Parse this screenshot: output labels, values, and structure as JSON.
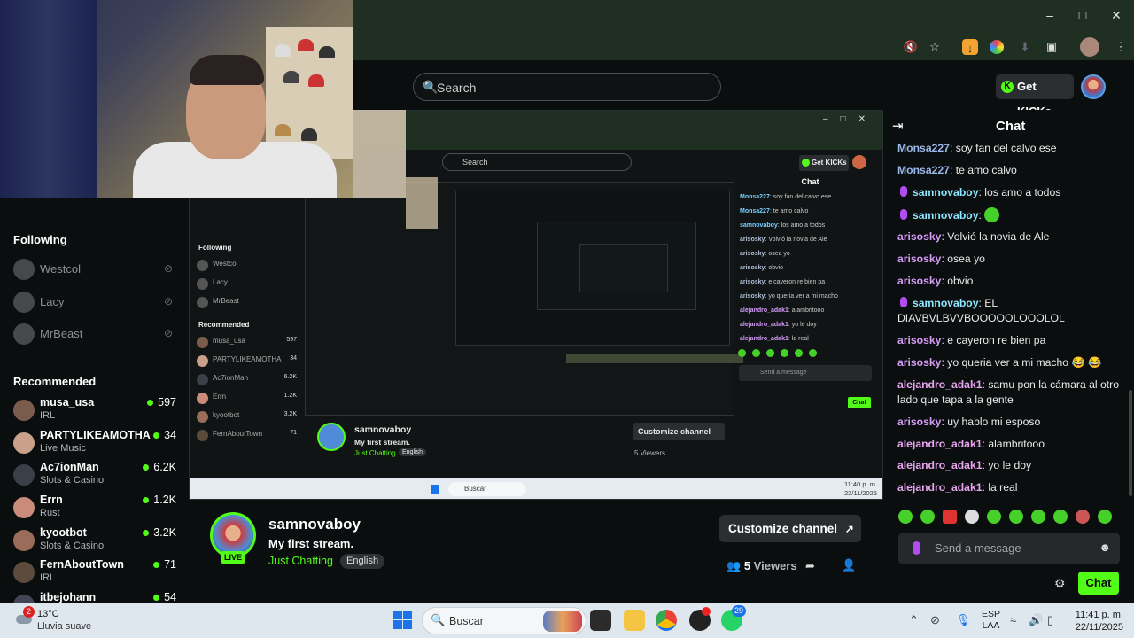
{
  "browser": {
    "toolbar_icons": [
      "mute-tab-icon",
      "bookmark-star-icon",
      "download-icon",
      "extension-icon",
      "profile-avatar"
    ]
  },
  "header": {
    "search_placeholder": "Search",
    "get_kicks_label": "Get KICKs"
  },
  "sidebar": {
    "following_title": "Following",
    "following": [
      {
        "name": "Westcol"
      },
      {
        "name": "Lacy"
      },
      {
        "name": "MrBeast"
      }
    ],
    "recommended_title": "Recommended",
    "recommended": [
      {
        "name": "musa_usa",
        "category": "IRL",
        "viewers": "597",
        "color": "#7a5c4c"
      },
      {
        "name": "PARTYLIKEAMOTHA",
        "category": "Live Music",
        "viewers": "34",
        "color": "#c9a08a"
      },
      {
        "name": "Ac7ionMan",
        "category": "Slots & Casino",
        "viewers": "6.2K",
        "color": "#3b3f48"
      },
      {
        "name": "Errn",
        "category": "Rust",
        "viewers": "1.2K",
        "color": "#c98b7a"
      },
      {
        "name": "kyootbot",
        "category": "Slots & Casino",
        "viewers": "3.2K",
        "color": "#9a6c5a"
      },
      {
        "name": "FernAboutTown",
        "category": "IRL",
        "viewers": "71",
        "color": "#5c4a3c"
      },
      {
        "name": "itbejohann",
        "category": "",
        "viewers": "54",
        "color": "#445"
      }
    ]
  },
  "stream": {
    "channel_name": "samnovaboy",
    "title": "My first stream.",
    "category": "Just Chatting",
    "language": "English",
    "live_label": "LIVE",
    "customize_label": "Customize channel",
    "viewer_count": "5",
    "viewers_label": "Viewers"
  },
  "nested": {
    "search": "Search",
    "get_kicks": "Get KICKs",
    "following": "Following",
    "recommended": "Recommended",
    "follow_list": [
      "Westcol",
      "Lacy",
      "MrBeast"
    ],
    "rec_list": [
      {
        "name": "musa_usa",
        "v": "597"
      },
      {
        "name": "PARTYLIKEAMOTHA",
        "v": "34"
      },
      {
        "name": "Ac7ionMan",
        "v": "6.2K"
      },
      {
        "name": "Errn",
        "v": "1.2K"
      },
      {
        "name": "kyootbot",
        "v": "3.2K"
      },
      {
        "name": "FernAboutTown",
        "v": "71"
      }
    ],
    "chat_title": "Chat",
    "chat": [
      {
        "u": "Monsa227",
        "t": "soy fan del calvo ese",
        "c": "p"
      },
      {
        "u": "Monsa227",
        "t": "te amo calvo",
        "c": "p"
      },
      {
        "u": "samnovaboy",
        "t": "los amo a todos",
        "c": "p"
      },
      {
        "u": "arisosky",
        "t": "Volvió la novia de Ale",
        "c": ""
      },
      {
        "u": "arisosky",
        "t": "osea yo",
        "c": ""
      },
      {
        "u": "arisosky",
        "t": "obvio",
        "c": ""
      },
      {
        "u": "arisosky",
        "t": "e cayeron re bien pa",
        "c": ""
      },
      {
        "u": "arisosky",
        "t": "yo queria ver a mi macho",
        "c": ""
      },
      {
        "u": "alejandro_adak1",
        "t": "alambritooo",
        "c": "a"
      },
      {
        "u": "alejandro_adak1",
        "t": "yo le doy",
        "c": "a"
      },
      {
        "u": "alejandro_adak1",
        "t": "la real",
        "c": "a"
      }
    ],
    "send_placeholder": "Send a message",
    "chat_btn": "Chat",
    "channel": "samnovaboy",
    "title": "My first stream.",
    "category": "Just Chatting",
    "lang": "English",
    "customize": "Customize channel",
    "viewers": "5 Viewers",
    "taskbar_search": "Buscar",
    "time": "11:40 p. m.",
    "date": "22/11/2025"
  },
  "chat": {
    "title": "Chat",
    "messages": [
      {
        "user": "Monsa227",
        "text": "soy fan del calvo ese",
        "color": "monsa",
        "mic": false
      },
      {
        "user": "Monsa227",
        "text": "te amo calvo",
        "color": "monsa",
        "mic": false
      },
      {
        "user": "samnovaboy",
        "text": "los amo a todos",
        "color": "samno",
        "mic": true
      },
      {
        "user": "samnovaboy",
        "text": "",
        "color": "samno",
        "mic": true,
        "emote": true
      },
      {
        "user": "arisosky",
        "text": "Volvió la novia de Ale",
        "color": "ari",
        "mic": false
      },
      {
        "user": "arisosky",
        "text": "osea yo",
        "color": "ari",
        "mic": false
      },
      {
        "user": "arisosky",
        "text": "obvio",
        "color": "ari",
        "mic": false
      },
      {
        "user": "samnovaboy",
        "text": "EL DIAVBVLBVVBOOOOOLOOOLOL",
        "color": "samno",
        "mic": true
      },
      {
        "user": "arisosky",
        "text": "e cayeron re bien pa",
        "color": "ari",
        "mic": false
      },
      {
        "user": "arisosky",
        "text": "yo queria ver a mi macho 😂 😂",
        "color": "ari",
        "mic": false
      },
      {
        "user": "alejandro_adak1",
        "text": "samu pon la cámara al otro lado que tapa a la gente",
        "color": "ale",
        "mic": false
      },
      {
        "user": "arisosky",
        "text": "uy hablo mi esposo",
        "color": "ari",
        "mic": false
      },
      {
        "user": "alejandro_adak1",
        "text": "alambritooo",
        "color": "ale",
        "mic": false
      },
      {
        "user": "alejandro_adak1",
        "text": "yo le doy",
        "color": "ale",
        "mic": false
      },
      {
        "user": "alejandro_adak1",
        "text": "la real",
        "color": "ale",
        "mic": false
      }
    ],
    "send_placeholder": "Send a message",
    "send_label": "Chat"
  },
  "taskbar": {
    "temperature": "13°C",
    "weather": "Lluvia suave",
    "weather_badge": "2",
    "search_label": "Buscar",
    "whatsapp_badge": "29",
    "lang_top": "ESP",
    "lang_bottom": "LAA",
    "time": "11:41 p. m.",
    "date": "22/11/2025"
  }
}
